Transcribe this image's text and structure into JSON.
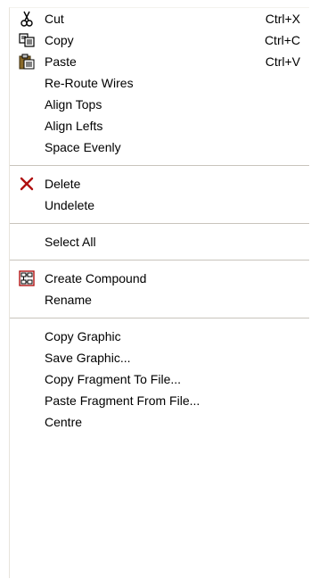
{
  "menu": {
    "cut": {
      "label": "Cut",
      "shortcut": "Ctrl+X",
      "icon": "scissors-icon"
    },
    "copy": {
      "label": "Copy",
      "shortcut": "Ctrl+C",
      "icon": "copy-icon"
    },
    "paste": {
      "label": "Paste",
      "shortcut": "Ctrl+V",
      "icon": "paste-icon"
    },
    "reroute": {
      "label": "Re-Route Wires"
    },
    "align_tops": {
      "label": "Align Tops"
    },
    "align_lefts": {
      "label": "Align Lefts"
    },
    "space_evenly": {
      "label": "Space Evenly"
    },
    "delete": {
      "label": "Delete",
      "icon": "delete-x-icon",
      "icon_color": "#b01010"
    },
    "undelete": {
      "label": "Undelete"
    },
    "select_all": {
      "label": "Select All"
    },
    "create_compound": {
      "label": "Create Compound",
      "icon": "compound-icon"
    },
    "rename": {
      "label": "Rename"
    },
    "copy_graphic": {
      "label": "Copy Graphic"
    },
    "save_graphic": {
      "label": "Save Graphic..."
    },
    "copy_fragment": {
      "label": "Copy Fragment To File..."
    },
    "paste_fragment": {
      "label": "Paste Fragment From File..."
    },
    "centre": {
      "label": "Centre"
    }
  }
}
